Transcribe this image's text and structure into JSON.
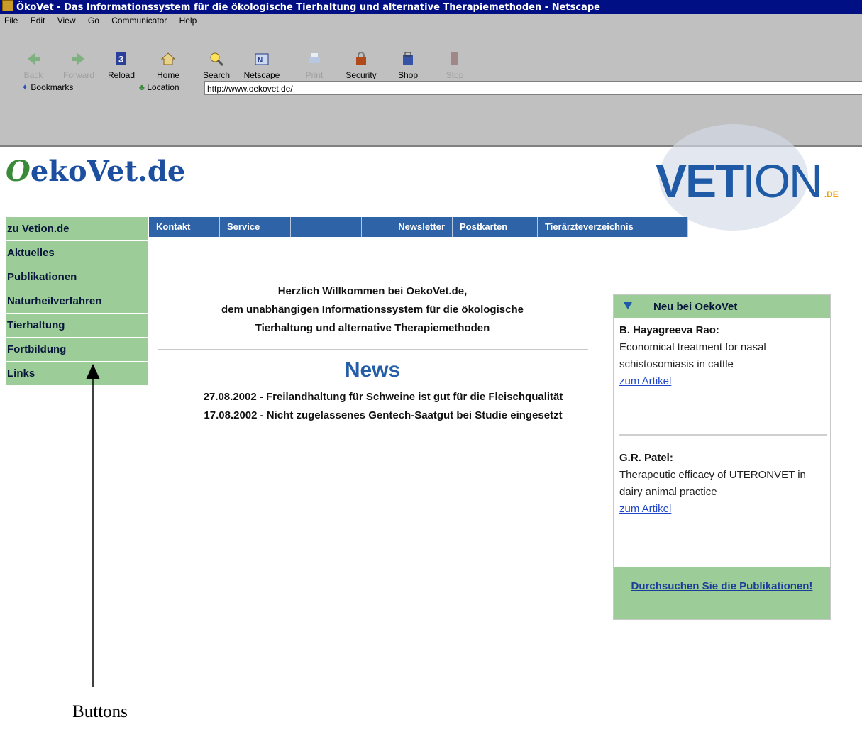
{
  "window": {
    "title": "ÖkoVet - Das Informationssystem für die ökologische Tierhaltung und alternative Therapiemethoden - Netscape"
  },
  "menubar": [
    "File",
    "Edit",
    "View",
    "Go",
    "Communicator",
    "Help"
  ],
  "toolbar": [
    {
      "label": "Back",
      "icon": "back-arrow-icon",
      "enabled": false
    },
    {
      "label": "Forward",
      "icon": "forward-arrow-icon",
      "enabled": false
    },
    {
      "label": "Reload",
      "icon": "reload-icon",
      "enabled": true
    },
    {
      "label": "Home",
      "icon": "home-icon",
      "enabled": true
    },
    {
      "label": "Search",
      "icon": "search-icon",
      "enabled": true
    },
    {
      "label": "Netscape",
      "icon": "netscape-icon",
      "enabled": true
    },
    {
      "label": "Print",
      "icon": "print-icon",
      "enabled": false
    },
    {
      "label": "Security",
      "icon": "lock-icon",
      "enabled": true
    },
    {
      "label": "Shop",
      "icon": "shop-icon",
      "enabled": true
    },
    {
      "label": "Stop",
      "icon": "stop-icon",
      "enabled": false
    }
  ],
  "location": {
    "bookmarks_label": "Bookmarks",
    "location_label": "Location",
    "url": "http://www.oekovet.de/"
  },
  "site": {
    "logo_prefix": "O",
    "logo_rest": "ekoVet.de",
    "vetion_vet": "VET",
    "vetion_ion": "ION",
    "vetion_de": ".DE"
  },
  "sidebar": [
    "zu Vetion.de",
    "Aktuelles",
    "Publikationen",
    "Naturheilverfahren",
    "Tierhaltung",
    "Fortbildung",
    "Links"
  ],
  "topnav": [
    "Kontakt",
    "Service",
    "",
    "Newsletter",
    "Postkarten",
    "Tierärzteverzeichnis"
  ],
  "welcome": {
    "line1": "Herzlich Willkommen bei OekoVet.de,",
    "line2": "dem unabhängigen Informationssystem für die ökologische",
    "line3": "Tierhaltung und alternative Therapiemethoden"
  },
  "news": {
    "heading": "News",
    "items": [
      "27.08.2002 - Freilandhaltung für Schweine ist gut für die Fleischqualität",
      "17.08.2002 - Nicht zugelassenes Gentech-Saatgut bei Studie eingesetzt"
    ]
  },
  "neu": {
    "title": "Neu bei OekoVet",
    "articles": [
      {
        "author": "B. Hayagreeva Rao:",
        "text": "Economical treatment for nasal schistosomiasis in cattle",
        "link": "zum Artikel"
      },
      {
        "author": "G.R. Patel:",
        "text": "Therapeutic efficacy of UTERONVET in dairy animal practice",
        "link": "zum Artikel"
      }
    ],
    "footer_link": "Durchsuchen Sie die Publikationen!"
  },
  "callout": {
    "label": "Buttons"
  },
  "colors": {
    "title_bar": "#000f84",
    "chrome": "#c0c0c0",
    "side_green": "#9ccc98",
    "nav_blue": "#2f63a8",
    "link": "#1f47c8"
  }
}
